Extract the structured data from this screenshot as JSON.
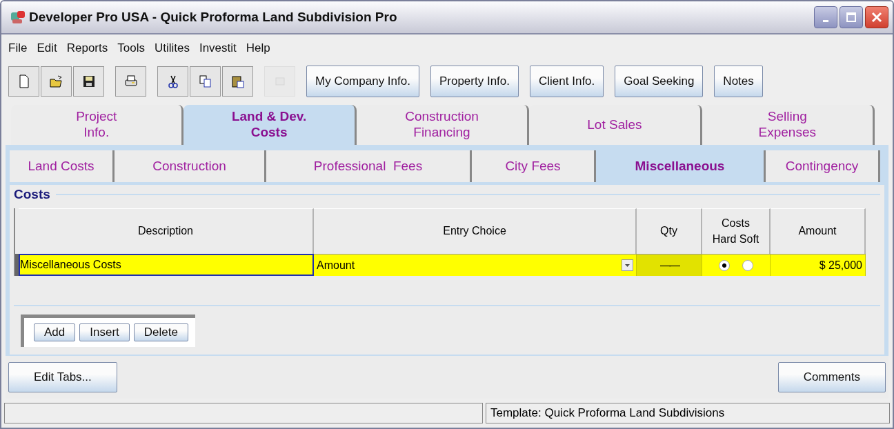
{
  "window": {
    "title": "Developer Pro  USA - Quick Proforma Land Subdivision Pro"
  },
  "menu": [
    "File",
    "Edit",
    "Reports",
    "Tools",
    "Utilites",
    "Investit",
    "Help"
  ],
  "toolbar_icons": [
    {
      "kind": "new",
      "disabled": false
    },
    {
      "kind": "open",
      "disabled": false
    },
    {
      "kind": "save",
      "disabled": false
    },
    {
      "kind": "print",
      "disabled": false
    },
    {
      "kind": "cut",
      "disabled": false
    },
    {
      "kind": "copy",
      "disabled": false
    },
    {
      "kind": "paste",
      "disabled": false
    },
    {
      "kind": "export",
      "disabled": true
    }
  ],
  "toolbar_buttons": [
    "My Company Info.",
    "Property Info.",
    "Client Info.",
    "Goal Seeking",
    "Notes"
  ],
  "tabs": [
    {
      "label": "Project\nInfo.",
      "selected": false
    },
    {
      "label": "Land & Dev.\nCosts",
      "selected": true
    },
    {
      "label": "Construction\nFinancing",
      "selected": false
    },
    {
      "label": "Lot Sales",
      "selected": false
    },
    {
      "label": "Selling\nExpenses",
      "selected": false
    }
  ],
  "subtabs": [
    {
      "label": "Land Costs",
      "selected": false
    },
    {
      "label": "Construction",
      "selected": false
    },
    {
      "label": "Professional  Fees",
      "selected": false
    },
    {
      "label": "City Fees",
      "selected": false
    },
    {
      "label": "Miscellaneous",
      "selected": true
    },
    {
      "label": "Contingency",
      "selected": false
    }
  ],
  "section": {
    "title": "Costs"
  },
  "table": {
    "columns": [
      "Description",
      "Entry Choice",
      "Qty",
      "Costs\nHard Soft",
      "Amount"
    ],
    "rows": [
      {
        "description": "Miscellaneous Costs",
        "entry_choice": "Amount",
        "qty": "——",
        "cost_type": [
          {
            "selected": true
          },
          {
            "selected": false
          }
        ],
        "amount": "$ 25,000",
        "selected": true
      }
    ]
  },
  "row_buttons": [
    "Add",
    "Insert",
    "Delete"
  ],
  "footer": {
    "left_button": "Edit Tabs...",
    "right_button": "Comments"
  },
  "status_bar": {
    "text": "Template: Quick Proforma Land Subdivisions"
  }
}
